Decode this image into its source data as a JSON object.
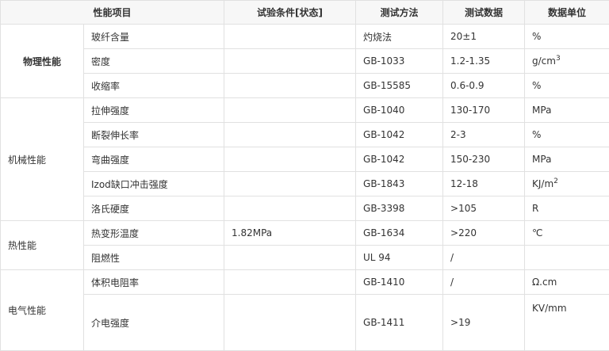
{
  "header": {
    "item": "性能项目",
    "condition": "试验条件[状态]",
    "method": "测试方法",
    "data": "测试数据",
    "unit": "数据单位"
  },
  "groups": [
    {
      "category": "物理性能",
      "rows": [
        {
          "item": "玻纤含量",
          "condition": "",
          "method": "灼烧法",
          "data": "20±1",
          "unit": "%"
        },
        {
          "item": "密度",
          "condition": "",
          "method": "GB-1033",
          "data": "1.2-1.35",
          "unit": "g/cm",
          "unit_sup": "3"
        },
        {
          "item": "收缩率",
          "condition": "",
          "method": "GB-15585",
          "data": "0.6-0.9",
          "unit": "%"
        }
      ]
    },
    {
      "category": "机械性能",
      "rows": [
        {
          "item": "拉伸强度",
          "condition": "",
          "method": "GB-1040",
          "data": "130-170",
          "unit": "MPa"
        },
        {
          "item": "断裂伸长率",
          "condition": "",
          "method": "GB-1042",
          "data": "2-3",
          "unit": "%"
        },
        {
          "item": "弯曲强度",
          "condition": "",
          "method": "GB-1042",
          "data": "150-230",
          "unit": "MPa"
        },
        {
          "item": "Izod缺口冲击强度",
          "condition": "",
          "method": "GB-1843",
          "data": "12-18",
          "unit": "KJ/m",
          "unit_sup": "2"
        },
        {
          "item": "洛氏硬度",
          "condition": "",
          "method": "GB-3398",
          "data": ">105",
          "unit": "R"
        }
      ]
    },
    {
      "category": "热性能",
      "rows": [
        {
          "item": "热变形温度",
          "condition": "1.82MPa",
          "method": "GB-1634",
          "data": ">220",
          "unit": "℃"
        },
        {
          "item": "阻燃性",
          "condition": "",
          "method": "UL 94",
          "data": "/",
          "unit": ""
        }
      ]
    },
    {
      "category": "电气性能",
      "rows": [
        {
          "item": "体积电阻率",
          "condition": "",
          "method": "GB-1410",
          "data": "/",
          "unit": "Ω.cm"
        },
        {
          "item": "介电强度",
          "condition": "",
          "method": "GB-1411",
          "data": ">19",
          "unit": "KV/mm"
        }
      ]
    }
  ]
}
